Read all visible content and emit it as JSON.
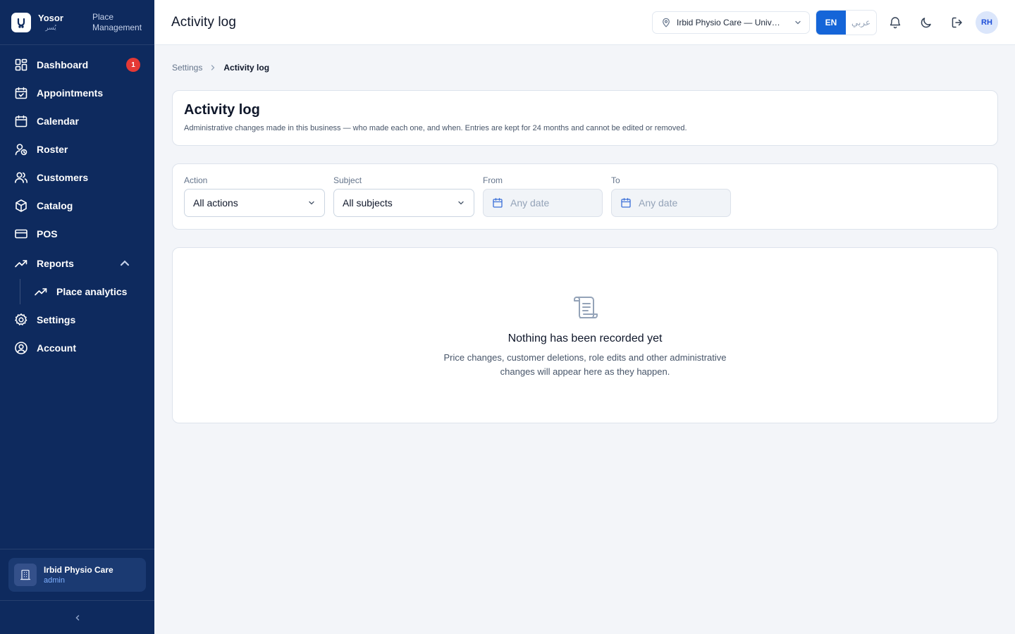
{
  "brand": {
    "name": "Yosor",
    "name_ar": "يُسر",
    "subtitle": "Place Management"
  },
  "sidebar": {
    "items": [
      {
        "label": "Dashboard",
        "icon": "grid-icon",
        "badge": "1"
      },
      {
        "label": "Appointments",
        "icon": "calendar-check-icon"
      },
      {
        "label": "Calendar",
        "icon": "calendar-icon"
      },
      {
        "label": "Roster",
        "icon": "user-clock-icon"
      },
      {
        "label": "Customers",
        "icon": "users-icon"
      },
      {
        "label": "Catalog",
        "icon": "box-icon"
      },
      {
        "label": "POS",
        "icon": "credit-card-icon"
      },
      {
        "label": "Reports",
        "icon": "trend-icon",
        "expanded": true
      },
      {
        "label": "Place analytics",
        "icon": "trend-icon"
      },
      {
        "label": "Settings",
        "icon": "gear-icon"
      },
      {
        "label": "Account",
        "icon": "user-circle-icon"
      }
    ],
    "business": {
      "name": "Irbid Physio Care",
      "role": "admin"
    }
  },
  "header": {
    "title": "Activity log",
    "location": "Irbid Physio Care — University Street",
    "lang_en": "EN",
    "lang_ar": "عربي",
    "avatar": "RH"
  },
  "breadcrumb": {
    "parent": "Settings",
    "current": "Activity log"
  },
  "intro": {
    "title": "Activity log",
    "description": "Administrative changes made in this business — who made each one, and when. Entries are kept for 24 months and cannot be edited or removed."
  },
  "filters": {
    "action": {
      "label": "Action",
      "value": "All actions"
    },
    "subject": {
      "label": "Subject",
      "value": "All subjects"
    },
    "from": {
      "label": "From",
      "placeholder": "Any date"
    },
    "to": {
      "label": "To",
      "placeholder": "Any date"
    }
  },
  "empty": {
    "title": "Nothing has been recorded yet",
    "description": "Price changes, customer deletions, role edits and other administrative changes will appear here as they happen."
  },
  "colors": {
    "sidebar": "#0e2a5e",
    "accent": "#1565d8",
    "badge": "#e53935"
  }
}
